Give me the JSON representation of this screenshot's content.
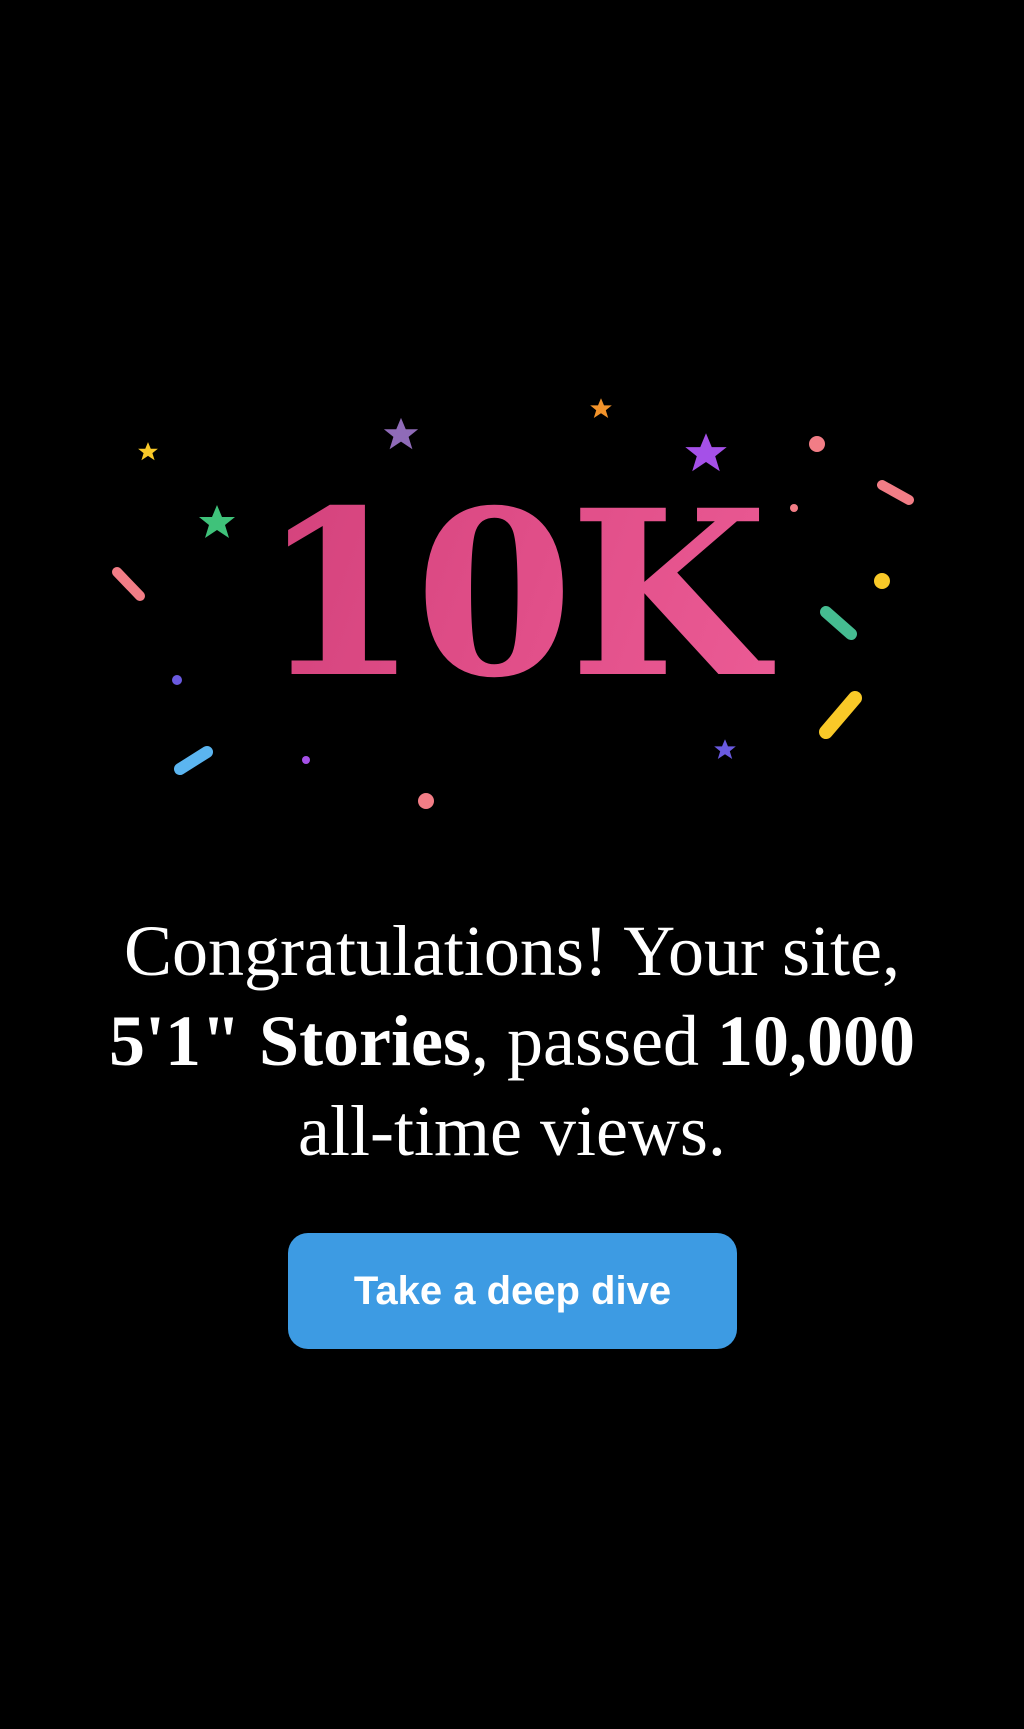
{
  "milestone": {
    "label": "10K",
    "gradient": [
      "#c83771",
      "#f466a0"
    ]
  },
  "message": {
    "part1": "Congratulations! Your site, ",
    "site_name": "5'1\" Stories",
    "part2": ", passed ",
    "views": "10,000",
    "part3": " all-time views."
  },
  "cta": {
    "label": "Take a deep dive",
    "color": "#3d9be3"
  },
  "confetti_colors": {
    "pink": "#f27d86",
    "yellow": "#f9c928",
    "green": "#3fc27a",
    "teal": "#45bc91",
    "blue": "#5bb5f0",
    "purple": "#a550e8",
    "lavender": "#8f6bb8",
    "indigo": "#6a5ae0",
    "orange": "#f3932a"
  },
  "icons": [
    "star-icon",
    "confetti-dot-icon",
    "confetti-streamer-icon"
  ]
}
